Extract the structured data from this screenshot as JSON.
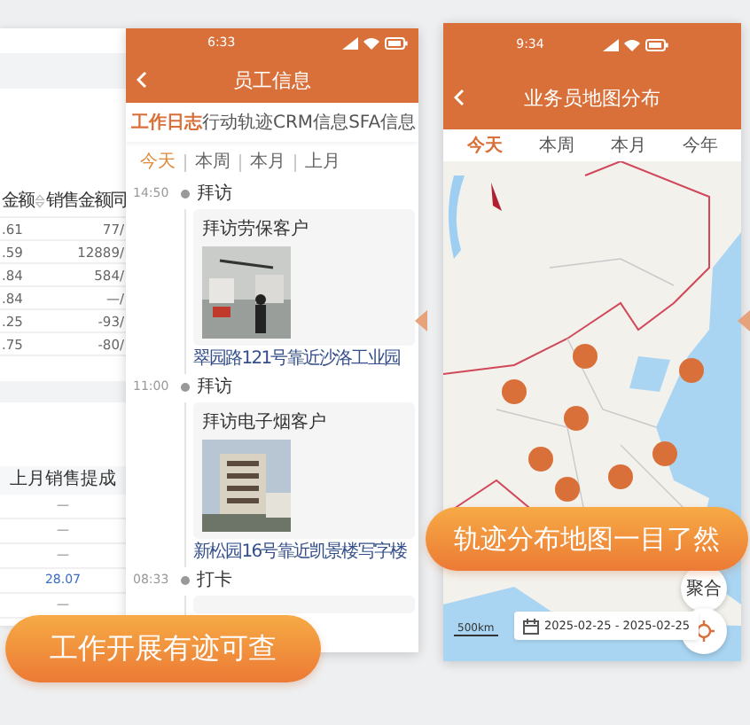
{
  "sales_panel": {
    "table_1": {
      "columns": [
        "金额",
        "销售金额同"
      ],
      "rows": [
        [
          ".61",
          "77/"
        ],
        [
          ".59",
          "12889/"
        ],
        [
          ".84",
          "584/"
        ],
        [
          ".84",
          "—/"
        ],
        [
          ".25",
          "-93/"
        ],
        [
          ".75",
          "-80/"
        ]
      ]
    },
    "table_2": {
      "column": "上月销售提成",
      "rows": [
        {
          "text": "—",
          "link": false
        },
        {
          "text": "—",
          "link": false
        },
        {
          "text": "—",
          "link": false
        },
        {
          "text": "28.07",
          "link": true
        },
        {
          "text": "—",
          "link": false
        }
      ]
    }
  },
  "employee_screen": {
    "status_time": "6:33",
    "title": "员工信息",
    "tabs": [
      {
        "label": "工作日志",
        "selected": true
      },
      {
        "label": "行动轨迹",
        "selected": false
      },
      {
        "label": "CRM信息",
        "selected": false
      },
      {
        "label": "SFA信息",
        "selected": false
      }
    ],
    "filters": [
      {
        "label": "今天",
        "selected": true
      },
      {
        "label": "本周",
        "selected": false
      },
      {
        "label": "本月",
        "selected": false
      },
      {
        "label": "上月",
        "selected": false
      }
    ],
    "timeline": [
      {
        "time": "14:50",
        "label": "拜访",
        "card": {
          "kind": "visit",
          "title": "拜访劳保客户",
          "address": "翠园路121号靠近沙洛工业园"
        }
      },
      {
        "time": "11:00",
        "label": "拜访",
        "card": {
          "kind": "visit",
          "title": "拜访电子烟客户",
          "address": "新松园16号靠近凯景楼写字楼"
        }
      },
      {
        "time": "08:33",
        "label": "打卡",
        "card": {
          "kind": "empty"
        }
      }
    ]
  },
  "map_screen": {
    "status_time": "9:34",
    "title": "业务员地图分布",
    "tabs": [
      {
        "label": "今天",
        "selected": true
      },
      {
        "label": "本周",
        "selected": false
      },
      {
        "label": "本月",
        "selected": false
      },
      {
        "label": "今年",
        "selected": false
      }
    ],
    "scale": "500km",
    "cluster_button": "聚合",
    "date_range": "2025-02-25 - 2025-02-25"
  },
  "captions": [
    "工作开展有迹可查",
    "轨迹分布地图一目了然"
  ]
}
